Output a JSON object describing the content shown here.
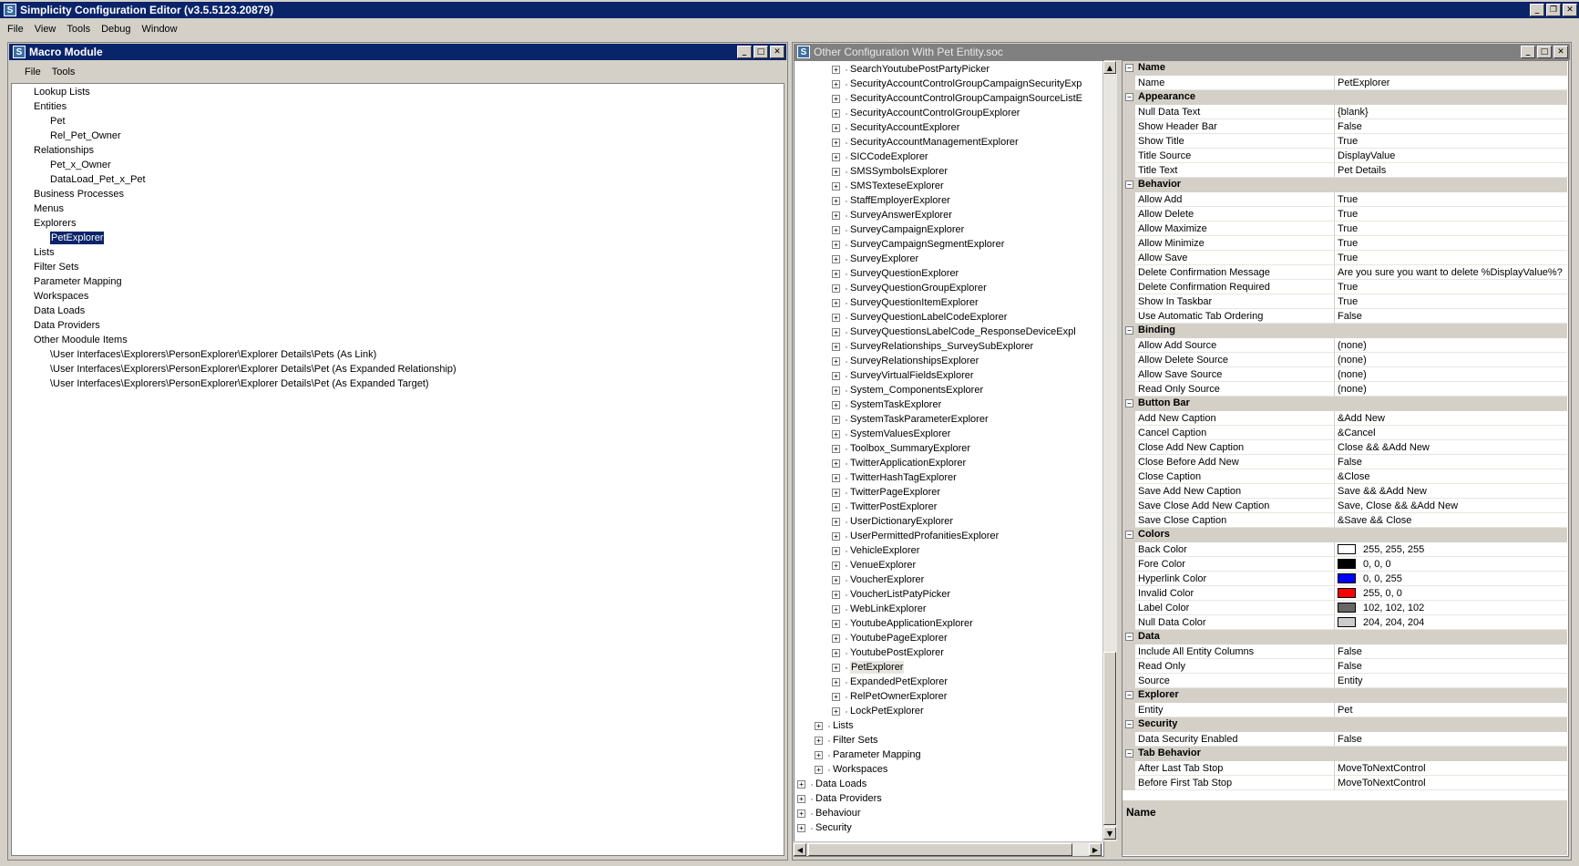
{
  "app": {
    "title": "Simplicity Configuration Editor (v3.5.5123.20879)",
    "icon_letter": "S",
    "menu": [
      "File",
      "View",
      "Tools",
      "Debug",
      "Window"
    ]
  },
  "macro": {
    "title": "Macro Module",
    "menu": [
      "File",
      "Tools"
    ],
    "tree": [
      {
        "label": "Lookup Lists",
        "level": 0
      },
      {
        "label": "Entities",
        "level": 0
      },
      {
        "label": "Pet",
        "level": 1
      },
      {
        "label": "Rel_Pet_Owner",
        "level": 1
      },
      {
        "label": "Relationships",
        "level": 0
      },
      {
        "label": "Pet_x_Owner",
        "level": 1
      },
      {
        "label": "DataLoad_Pet_x_Pet",
        "level": 1
      },
      {
        "label": "Business Processes",
        "level": 0
      },
      {
        "label": "Menus",
        "level": 0
      },
      {
        "label": "Explorers",
        "level": 0
      },
      {
        "label": "PetExplorer",
        "level": 1,
        "selected": true
      },
      {
        "label": "Lists",
        "level": 0
      },
      {
        "label": "Filter Sets",
        "level": 0
      },
      {
        "label": "Parameter Mapping",
        "level": 0
      },
      {
        "label": "Workspaces",
        "level": 0
      },
      {
        "label": "Data Loads",
        "level": 0
      },
      {
        "label": "Data Providers",
        "level": 0
      },
      {
        "label": "Other Moodule Items",
        "level": 0
      },
      {
        "label": "\\User Interfaces\\Explorers\\PersonExplorer\\Explorer Details\\Pets (As Link)",
        "level": 1
      },
      {
        "label": "\\User Interfaces\\Explorers\\PersonExplorer\\Explorer Details\\Pet (As Expanded Relationship)",
        "level": 1
      },
      {
        "label": "\\User Interfaces\\Explorers\\PersonExplorer\\Explorer Details\\Pet (As Expanded Target)",
        "level": 1
      }
    ]
  },
  "config": {
    "title": "Other Configuration With Pet Entity.soc",
    "tree": [
      {
        "label": "SearchYoutubePostPartyPicker",
        "level": 3
      },
      {
        "label": "SecurityAccountControlGroupCampaignSecurityExp",
        "level": 3
      },
      {
        "label": "SecurityAccountControlGroupCampaignSourceListE",
        "level": 3
      },
      {
        "label": "SecurityAccountControlGroupExplorer",
        "level": 3
      },
      {
        "label": "SecurityAccountExplorer",
        "level": 3
      },
      {
        "label": "SecurityAccountManagementExplorer",
        "level": 3
      },
      {
        "label": "SICCodeExplorer",
        "level": 3
      },
      {
        "label": "SMSSymbolsExplorer",
        "level": 3
      },
      {
        "label": "SMSTexteseExplorer",
        "level": 3
      },
      {
        "label": "StaffEmployerExplorer",
        "level": 3
      },
      {
        "label": "SurveyAnswerExplorer",
        "level": 3
      },
      {
        "label": "SurveyCampaignExplorer",
        "level": 3
      },
      {
        "label": "SurveyCampaignSegmentExplorer",
        "level": 3
      },
      {
        "label": "SurveyExplorer",
        "level": 3
      },
      {
        "label": "SurveyQuestionExplorer",
        "level": 3
      },
      {
        "label": "SurveyQuestionGroupExplorer",
        "level": 3
      },
      {
        "label": "SurveyQuestionItemExplorer",
        "level": 3
      },
      {
        "label": "SurveyQuestionLabelCodeExplorer",
        "level": 3
      },
      {
        "label": "SurveyQuestionsLabelCode_ResponseDeviceExpl",
        "level": 3
      },
      {
        "label": "SurveyRelationships_SurveySubExplorer",
        "level": 3
      },
      {
        "label": "SurveyRelationshipsExplorer",
        "level": 3
      },
      {
        "label": "SurveyVirtualFieldsExplorer",
        "level": 3
      },
      {
        "label": "System_ComponentsExplorer",
        "level": 3
      },
      {
        "label": "SystemTaskExplorer",
        "level": 3
      },
      {
        "label": "SystemTaskParameterExplorer",
        "level": 3
      },
      {
        "label": "SystemValuesExplorer",
        "level": 3
      },
      {
        "label": "Toolbox_SummaryExplorer",
        "level": 3
      },
      {
        "label": "TwitterApplicationExplorer",
        "level": 3
      },
      {
        "label": "TwitterHashTagExplorer",
        "level": 3
      },
      {
        "label": "TwitterPageExplorer",
        "level": 3
      },
      {
        "label": "TwitterPostExplorer",
        "level": 3
      },
      {
        "label": "UserDictionaryExplorer",
        "level": 3
      },
      {
        "label": "UserPermittedProfanitiesExplorer",
        "level": 3
      },
      {
        "label": "VehicleExplorer",
        "level": 3
      },
      {
        "label": "VenueExplorer",
        "level": 3
      },
      {
        "label": "VoucherExplorer",
        "level": 3
      },
      {
        "label": "VoucherListPatyPicker",
        "level": 3
      },
      {
        "label": "WebLinkExplorer",
        "level": 3
      },
      {
        "label": "YoutubeApplicationExplorer",
        "level": 3
      },
      {
        "label": "YoutubePageExplorer",
        "level": 3
      },
      {
        "label": "YoutubePostExplorer",
        "level": 3
      },
      {
        "label": "PetExplorer",
        "level": 3,
        "highlight": true
      },
      {
        "label": "ExpandedPetExplorer",
        "level": 3
      },
      {
        "label": "RelPetOwnerExplorer",
        "level": 3
      },
      {
        "label": "LockPetExplorer",
        "level": 3
      },
      {
        "label": "Lists",
        "level": 2
      },
      {
        "label": "Filter Sets",
        "level": 2
      },
      {
        "label": "Parameter Mapping",
        "level": 2
      },
      {
        "label": "Workspaces",
        "level": 2
      },
      {
        "label": "Data Loads",
        "level": 1
      },
      {
        "label": "Data Providers",
        "level": 1
      },
      {
        "label": "Behaviour",
        "level": 1
      },
      {
        "label": "Security",
        "level": 1
      }
    ]
  },
  "properties": {
    "rows": [
      {
        "type": "cat",
        "label": "Name"
      },
      {
        "type": "prop",
        "name": "Name",
        "value": "PetExplorer"
      },
      {
        "type": "cat",
        "label": "Appearance"
      },
      {
        "type": "prop",
        "name": "Null Data Text",
        "value": "{blank}"
      },
      {
        "type": "prop",
        "name": "Show Header Bar",
        "value": "False"
      },
      {
        "type": "prop",
        "name": "Show Title",
        "value": "True"
      },
      {
        "type": "prop",
        "name": "Title Source",
        "value": "DisplayValue"
      },
      {
        "type": "prop",
        "name": "Title Text",
        "value": "Pet Details"
      },
      {
        "type": "cat",
        "label": "Behavior"
      },
      {
        "type": "prop",
        "name": "Allow Add",
        "value": "True"
      },
      {
        "type": "prop",
        "name": "Allow Delete",
        "value": "True"
      },
      {
        "type": "prop",
        "name": "Allow Maximize",
        "value": "True"
      },
      {
        "type": "prop",
        "name": "Allow Minimize",
        "value": "True"
      },
      {
        "type": "prop",
        "name": "Allow Save",
        "value": "True"
      },
      {
        "type": "prop",
        "name": "Delete Confirmation Message",
        "value": "Are you sure you want to delete %DisplayValue%?"
      },
      {
        "type": "prop",
        "name": "Delete Confirmation Required",
        "value": "True"
      },
      {
        "type": "prop",
        "name": "Show In Taskbar",
        "value": "True"
      },
      {
        "type": "prop",
        "name": "Use Automatic Tab Ordering",
        "value": "False"
      },
      {
        "type": "cat",
        "label": "Binding"
      },
      {
        "type": "prop",
        "name": "Allow Add Source",
        "value": "(none)"
      },
      {
        "type": "prop",
        "name": "Allow Delete Source",
        "value": "(none)"
      },
      {
        "type": "prop",
        "name": "Allow Save Source",
        "value": "(none)"
      },
      {
        "type": "prop",
        "name": "Read Only Source",
        "value": "(none)"
      },
      {
        "type": "cat",
        "label": "Button Bar"
      },
      {
        "type": "prop",
        "name": "Add New Caption",
        "value": "&Add New"
      },
      {
        "type": "prop",
        "name": "Cancel Caption",
        "value": "&Cancel"
      },
      {
        "type": "prop",
        "name": "Close Add New Caption",
        "value": "Close && &Add New"
      },
      {
        "type": "prop",
        "name": "Close Before Add New",
        "value": "False"
      },
      {
        "type": "prop",
        "name": "Close Caption",
        "value": "&Close"
      },
      {
        "type": "prop",
        "name": "Save Add New Caption",
        "value": "Save && &Add New"
      },
      {
        "type": "prop",
        "name": "Save Close Add New Caption",
        "value": "Save, Close && &Add New"
      },
      {
        "type": "prop",
        "name": "Save Close Caption",
        "value": "&Save && Close"
      },
      {
        "type": "cat",
        "label": "Colors"
      },
      {
        "type": "prop",
        "name": "Back Color",
        "value": "255, 255, 255",
        "swatch": "#ffffff"
      },
      {
        "type": "prop",
        "name": "Fore Color",
        "value": "0, 0, 0",
        "swatch": "#000000"
      },
      {
        "type": "prop",
        "name": "Hyperlink Color",
        "value": "0, 0, 255",
        "swatch": "#0000ff"
      },
      {
        "type": "prop",
        "name": "Invalid Color",
        "value": "255, 0, 0",
        "swatch": "#ff0000"
      },
      {
        "type": "prop",
        "name": "Label Color",
        "value": "102, 102, 102",
        "swatch": "#666666"
      },
      {
        "type": "prop",
        "name": "Null Data Color",
        "value": "204, 204, 204",
        "swatch": "#cccccc"
      },
      {
        "type": "cat",
        "label": "Data"
      },
      {
        "type": "prop",
        "name": "Include All Entity Columns",
        "value": "False"
      },
      {
        "type": "prop",
        "name": "Read Only",
        "value": "False"
      },
      {
        "type": "prop",
        "name": "Source",
        "value": "Entity"
      },
      {
        "type": "cat",
        "label": "Explorer"
      },
      {
        "type": "prop",
        "name": "Entity",
        "value": "Pet"
      },
      {
        "type": "cat",
        "label": "Security"
      },
      {
        "type": "prop",
        "name": "Data Security Enabled",
        "value": "False"
      },
      {
        "type": "cat",
        "label": "Tab Behavior"
      },
      {
        "type": "prop",
        "name": "After Last Tab Stop",
        "value": "MoveToNextControl"
      },
      {
        "type": "prop",
        "name": "Before First Tab Stop",
        "value": "MoveToNextControl"
      }
    ],
    "description_title": "Name"
  },
  "glyphs": {
    "minimize": "_",
    "maximize": "□",
    "close": "✕",
    "restore": "❐",
    "expand": "+",
    "collapse": "−",
    "arrow_up": "▲",
    "arrow_down": "▼",
    "arrow_left": "◀",
    "arrow_right": "▶"
  }
}
